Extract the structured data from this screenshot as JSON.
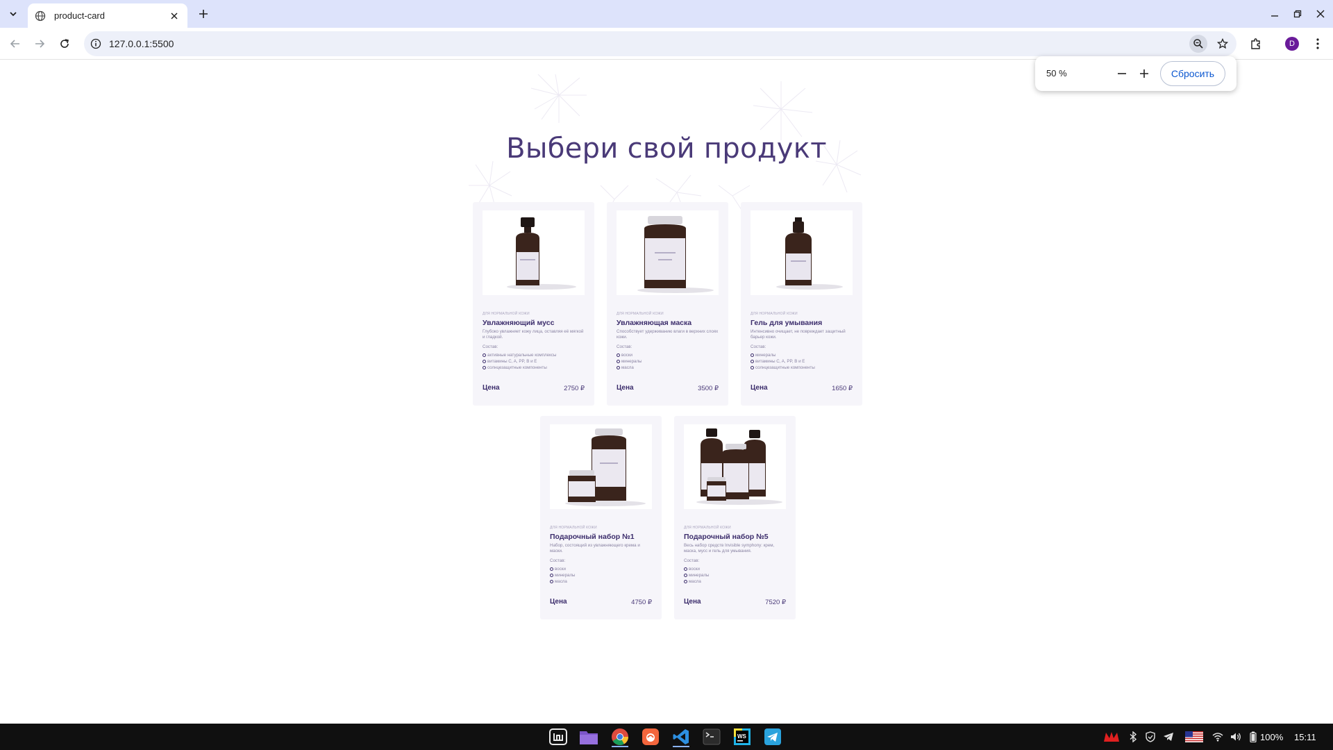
{
  "browser": {
    "tab_title": "product-card",
    "url": "127.0.0.1:5500",
    "profile_initial": "D",
    "zoom": {
      "value": "50 %",
      "reset_label": "Сбросить"
    }
  },
  "page": {
    "title": "Выбери свой продукт",
    "composition_label": "Состав:",
    "price_label": "Цена",
    "products": [
      {
        "tag": "для нормальной кожи",
        "name": "Увлажняющий мусс",
        "description": "Глубоко увлажняет кожу лица, оставляя её мягкой и гладкой.",
        "composition": [
          "активные натуральные комплексы",
          "витамины C, A, PP, B и E",
          "солнцезащитные компоненты"
        ],
        "price": "2750 ₽",
        "image": "pump-bottle"
      },
      {
        "tag": "для нормальной кожи",
        "name": "Увлажняющая маска",
        "description": "Способствует удерживанию влаги в верхних слоях кожи.",
        "composition": [
          "воски",
          "минералы",
          "масла"
        ],
        "price": "3500 ₽",
        "image": "jar"
      },
      {
        "tag": "для нормальной кожи",
        "name": "Гель для умывания",
        "description": "Интенсивно очищает, не повреждает защитный барьер кожи.",
        "composition": [
          "минералы",
          "витамины C, A, PP, B и E",
          "солнцезащитные компоненты"
        ],
        "price": "1650 ₽",
        "image": "dropper-bottle"
      },
      {
        "tag": "для нормальной кожи",
        "name": "Подарочный набор №1",
        "description": "Набор, состоящий из увлажняющего крема и маски.",
        "composition": [
          "воски",
          "минералы",
          "масла"
        ],
        "price": "4750 ₽",
        "image": "jar-set"
      },
      {
        "tag": "для нормальной кожи",
        "name": "Подарочный набор №5",
        "description": "Весь набор средств Invisible symphony: крем, маска, мусс и гель для умывания.",
        "composition": [
          "воски",
          "минералы",
          "масла"
        ],
        "price": "7520 ₽",
        "image": "full-set"
      }
    ]
  },
  "taskbar": {
    "battery": "100%",
    "time": "15:11",
    "apps": [
      "mint-menu-icon",
      "files-icon",
      "chrome-icon",
      "firefox-icon",
      "vscode-icon",
      "terminal-icon",
      "webstorm-icon",
      "telegram-icon"
    ]
  }
}
